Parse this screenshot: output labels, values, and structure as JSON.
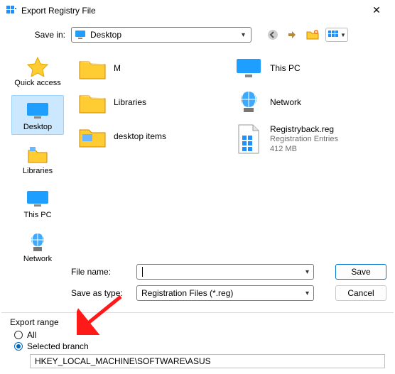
{
  "window": {
    "title": "Export Registry File"
  },
  "savein": {
    "label": "Save in:",
    "value": "Desktop"
  },
  "places": [
    {
      "id": "quick-access",
      "label": "Quick access"
    },
    {
      "id": "desktop",
      "label": "Desktop"
    },
    {
      "id": "libraries",
      "label": "Libraries"
    },
    {
      "id": "this-pc",
      "label": "This PC"
    },
    {
      "id": "network",
      "label": "Network"
    }
  ],
  "places_selected": "desktop",
  "files_left": [
    {
      "name": "M",
      "kind": "folder"
    },
    {
      "name": "Libraries",
      "kind": "folder"
    },
    {
      "name": "desktop items",
      "kind": "folder"
    }
  ],
  "files_right": [
    {
      "name": "This PC",
      "kind": "thispc"
    },
    {
      "name": "Network",
      "kind": "network"
    },
    {
      "name": "Registryback.reg",
      "kind": "regfile",
      "sub1": "Registration Entries",
      "sub2": "412 MB"
    }
  ],
  "filename": {
    "label": "File name:",
    "value": ""
  },
  "savetype": {
    "label": "Save as type:",
    "value": "Registration Files (*.reg)"
  },
  "buttons": {
    "save": "Save",
    "cancel": "Cancel"
  },
  "export": {
    "title": "Export range",
    "all": "All",
    "selected": "Selected branch",
    "choice": "selected",
    "branch": "HKEY_LOCAL_MACHINE\\SOFTWARE\\ASUS"
  }
}
